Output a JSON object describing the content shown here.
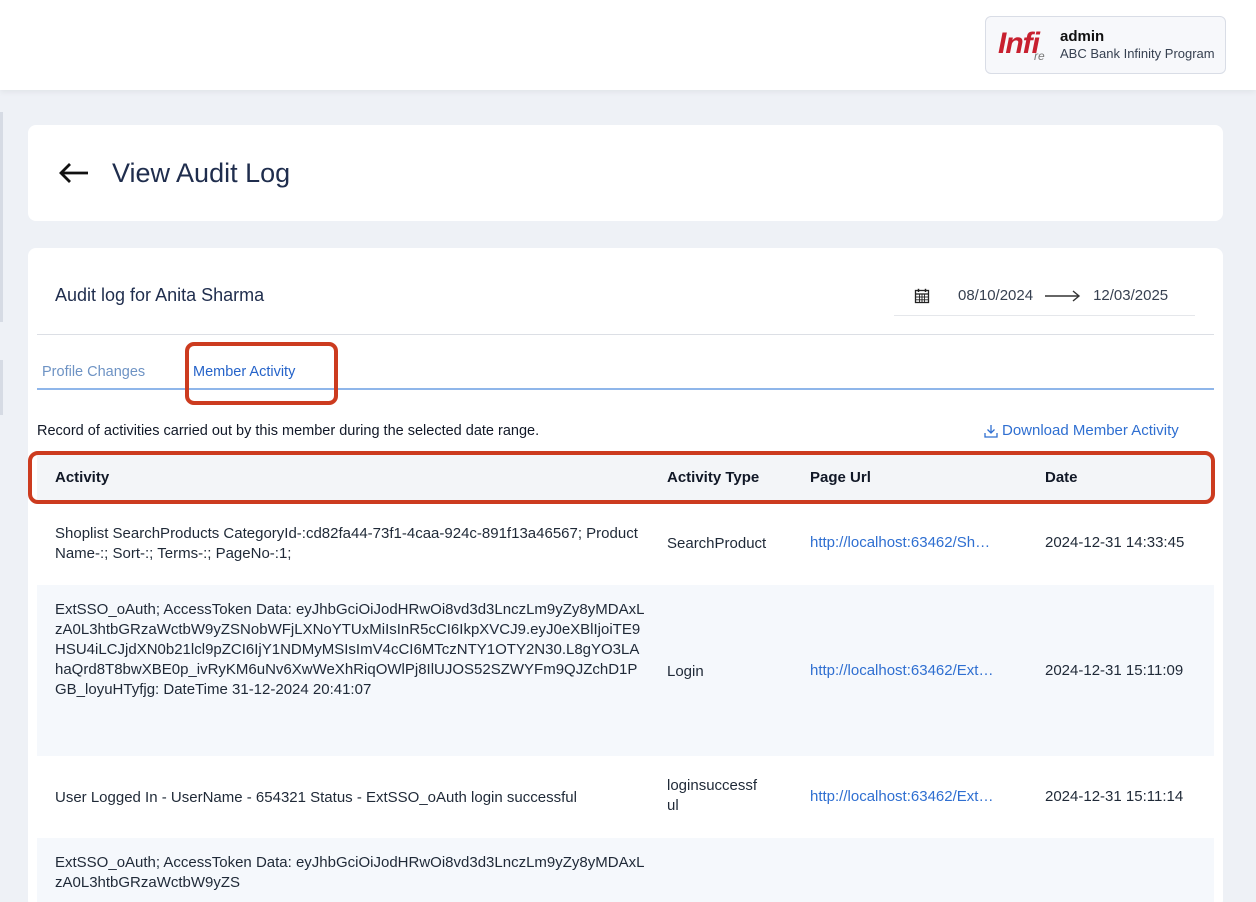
{
  "header": {
    "logo_text": "Infi",
    "logo_sub": "re",
    "user_name": "admin",
    "org_name": "ABC Bank Infinity Program"
  },
  "page": {
    "title": "View Audit Log",
    "subtitle": "Audit log for Anita Sharma"
  },
  "date_range": {
    "start": "08/10/2024",
    "end": "12/03/2025"
  },
  "tabs": [
    {
      "label": "Profile Changes",
      "active": false
    },
    {
      "label": "Member Activity",
      "active": true
    }
  ],
  "description": "Record of activities carried out by this member during the selected date range.",
  "download_label": "Download Member Activity",
  "table": {
    "columns": [
      "Activity",
      "Activity Type",
      "Page Url",
      "Date"
    ],
    "rows": [
      {
        "activity": "Shoplist SearchProducts CategoryId-:cd82fa44-73f1-4caa-924c-891f13a46567; ProductName-:; Sort-:; Terms-:; PageNo-:1;",
        "type": "SearchProduct",
        "url": "http://localhost:63462/Sh…",
        "date": "2024-12-31 14:33:45"
      },
      {
        "activity": "ExtSSO_oAuth; AccessToken Data: eyJhbGciOiJodHRwOi8vd3d3LnczLm9yZy8yMDAxLzA0L3htbGRzaWctbW9yZSNobWFjLXNoYTUxMiIsInR5cCI6IkpXVCJ9.eyJ0eXBlIjoiTE9HSU4iLCJjdXN0b21lcl9pZCI6IjY1NDMyMSIsImV4cCI6MTczNTY1OTY2N30.L8gYO3LAhaQrd8T8bwXBE0p_ivRyKM6uNv6XwWeXhRiqOWlPj8IlUJOS52SZWYFm9QJZchD1PGB_loyuHTyfjg: DateTime 31-12-2024 20:41:07",
        "type": "Login",
        "url": "http://localhost:63462/Ext…",
        "date": "2024-12-31 15:11:09"
      },
      {
        "activity": "User Logged In - UserName - 654321 Status - ExtSSO_oAuth login successful",
        "type": "loginsuccessful",
        "url": "http://localhost:63462/Ext…",
        "date": "2024-12-31 15:11:14"
      },
      {
        "activity": "ExtSSO_oAuth; AccessToken Data: eyJhbGciOiJodHRwOi8vd3d3LnczLm9yZy8yMDAxLzA0L3htbGRzaWctbW9yZS",
        "type": "",
        "url": "",
        "date": ""
      }
    ]
  },
  "colors": {
    "accent": "#2f6fd1",
    "highlight": "#cc3b1f",
    "logo": "#c8202f"
  }
}
